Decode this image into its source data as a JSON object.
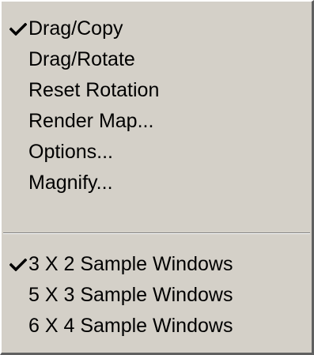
{
  "menu": {
    "group1": [
      {
        "label": "Drag/Copy",
        "checked": true
      },
      {
        "label": "Drag/Rotate",
        "checked": false
      },
      {
        "label": "Reset Rotation",
        "checked": false
      },
      {
        "label": "Render Map...",
        "checked": false
      },
      {
        "label": "Options...",
        "checked": false
      },
      {
        "label": "Magnify...",
        "checked": false
      }
    ],
    "group2": [
      {
        "label": "3 X 2 Sample Windows",
        "checked": true
      },
      {
        "label": "5 X 3 Sample Windows",
        "checked": false
      },
      {
        "label": "6 X 4 Sample Windows",
        "checked": false
      }
    ]
  },
  "icons": {
    "check": "check-mark-icon"
  }
}
